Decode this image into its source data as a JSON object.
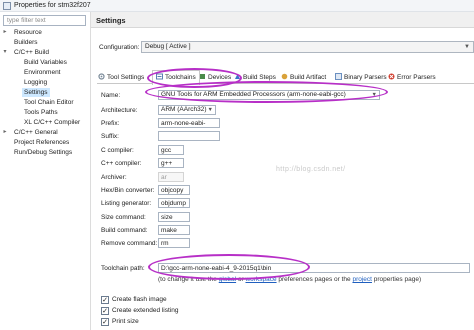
{
  "window": {
    "title": "Properties for stm32f207"
  },
  "filter": {
    "placeholder": "type filter text"
  },
  "nav": {
    "items": [
      {
        "label": "Resource"
      },
      {
        "label": "Builders"
      },
      {
        "label": "C/C++ Build"
      },
      {
        "label": "Build Variables"
      },
      {
        "label": "Environment"
      },
      {
        "label": "Logging"
      },
      {
        "label": "Settings"
      },
      {
        "label": "Tool Chain Editor"
      },
      {
        "label": "Tools Paths"
      },
      {
        "label": "XL C/C++ Compiler"
      },
      {
        "label": "C/C++ General"
      },
      {
        "label": "Project References"
      },
      {
        "label": "Run/Debug Settings"
      }
    ],
    "selected": "Settings"
  },
  "settings": {
    "title": "Settings"
  },
  "configuration": {
    "label": "Configuration:",
    "value": "Debug  [ Active ]"
  },
  "tabs": [
    {
      "label": "Tool Settings",
      "icon": "tool-settings-icon",
      "color": "#7a8a99"
    },
    {
      "label": "Toolchains",
      "icon": "toolchains-icon",
      "color": "#5b7fb3"
    },
    {
      "label": "Devices",
      "icon": "devices-icon",
      "color": "#4a8a4a"
    },
    {
      "label": "Build Steps",
      "icon": "build-steps-icon",
      "color": "#3a72c8"
    },
    {
      "label": "Build Artifact",
      "icon": "build-artifact-icon",
      "color": "#d9a23a"
    },
    {
      "label": "Binary Parsers",
      "icon": "binary-parsers-icon",
      "color": "#6a8fc0"
    },
    {
      "label": "Error Parsers",
      "icon": "error-parsers-icon",
      "color": "#d03a2a"
    }
  ],
  "form": {
    "fields": [
      {
        "label": "Name:",
        "value": "GNU Tools for ARM Embedded Processors (arm-none-eabi-gcc)",
        "type": "select"
      },
      {
        "label": "Architecture:",
        "value": "ARM (AArch32)",
        "type": "select"
      },
      {
        "label": "Prefix:",
        "value": "arm-none-eabi-",
        "type": "text"
      },
      {
        "label": "Suffix:",
        "value": "",
        "type": "text"
      },
      {
        "label": "C compiler:",
        "value": "gcc",
        "type": "text"
      },
      {
        "label": "C++ compiler:",
        "value": "g++",
        "type": "text"
      },
      {
        "label": "Archiver:",
        "value": "ar",
        "type": "disabled"
      },
      {
        "label": "Hex/Bin converter:",
        "value": "objcopy",
        "type": "text"
      },
      {
        "label": "Listing generator:",
        "value": "objdump",
        "type": "text"
      },
      {
        "label": "Size command:",
        "value": "size",
        "type": "text"
      },
      {
        "label": "Build command:",
        "value": "make",
        "type": "text"
      },
      {
        "label": "Remove command:",
        "value": "rm",
        "type": "text"
      }
    ],
    "toolchain_path": {
      "label": "Toolchain path:",
      "value": "D:\\gcc-arm-none-eabi-4_9-2015q1\\bin"
    }
  },
  "note": {
    "prefix": "(to change it use the ",
    "global_link": "global",
    "or": " or ",
    "workspace_link": "workspace",
    "mid": " preferences pages or the ",
    "project_link": "project",
    "suffix": " properties page)"
  },
  "checkboxes": [
    {
      "label": "Create flash image",
      "checked": true
    },
    {
      "label": "Create extended listing",
      "checked": true
    },
    {
      "label": "Print size",
      "checked": true
    }
  ],
  "watermark": "http://blog.csdn.net/",
  "highlight_color": "#b72fc7"
}
